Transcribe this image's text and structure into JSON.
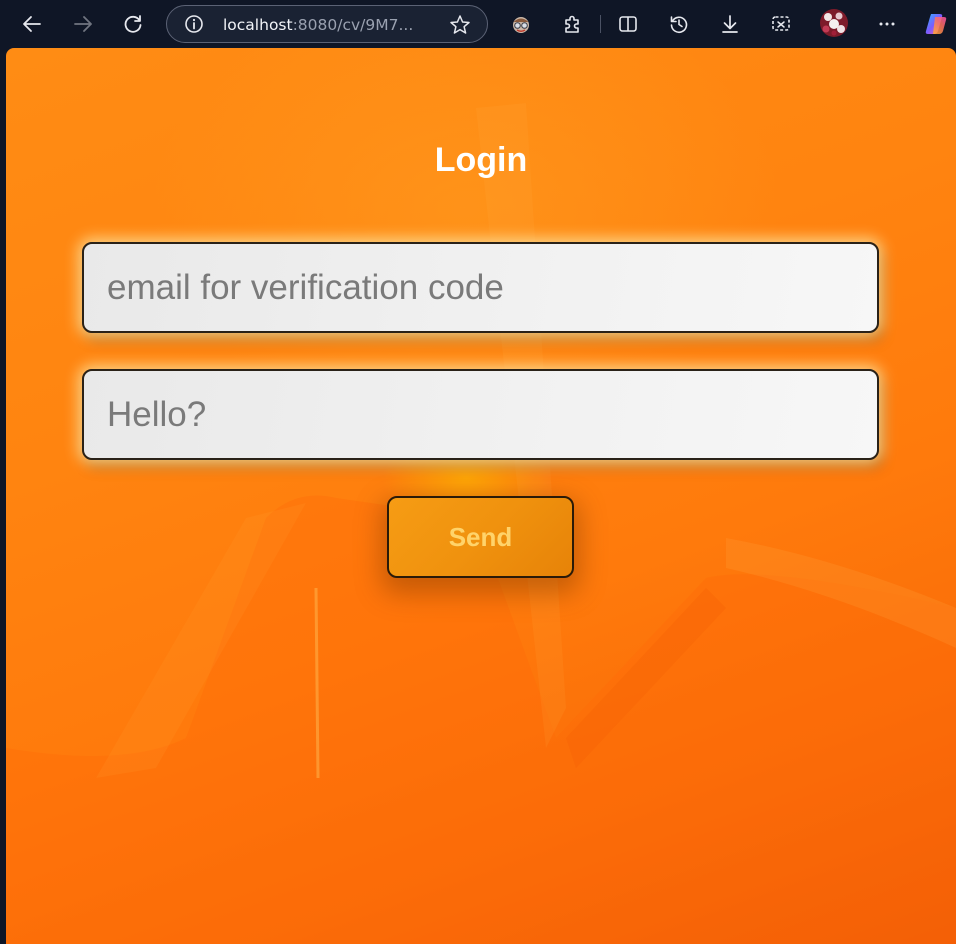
{
  "browser": {
    "address_bar": {
      "host": "localhost",
      "path": ":8080/cv/9M7..."
    },
    "icons": [
      "back-arrow-icon",
      "forward-arrow-icon",
      "refresh-icon",
      "site-info-icon",
      "favorite-star-icon",
      "extension-avatar-icon",
      "extensions-puzzle-icon",
      "split-screen-icon",
      "history-icon",
      "downloads-icon",
      "screenshot-icon",
      "profile-avatar",
      "more-options-icon",
      "copilot-icon"
    ]
  },
  "page": {
    "title": "Login",
    "email_input": {
      "placeholder": "email for verification code",
      "value": ""
    },
    "message_input": {
      "placeholder": "Hello?",
      "value": ""
    },
    "send_button": {
      "label": "Send"
    }
  },
  "colors": {
    "browser_chrome": "#0f1626",
    "page_background": "#ff8410",
    "title_text": "#ffffff",
    "button_background": "#f0920e",
    "button_text": "#ffd36a",
    "input_background": "#f1f1f1",
    "placeholder_text": "#7a7a7a"
  }
}
